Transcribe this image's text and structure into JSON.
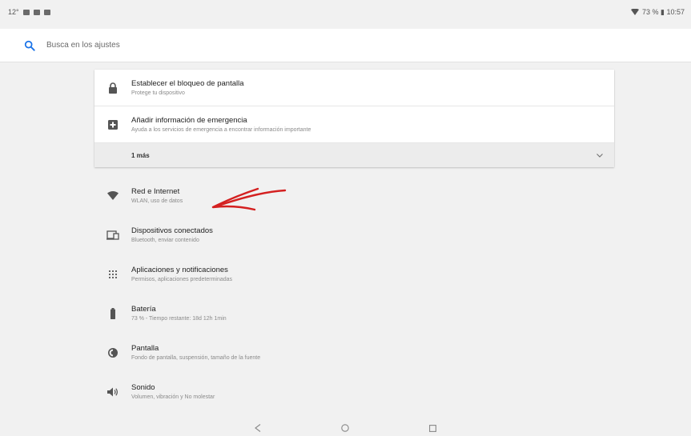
{
  "status_bar": {
    "left_text": "12°",
    "right_text": "73 % ▮ 10:57"
  },
  "search": {
    "placeholder": "Busca en los ajustes",
    "icon": "search-icon"
  },
  "suggestions": [
    {
      "icon": "lock-icon",
      "title": "Establecer el bloqueo de pantalla",
      "summary": "Protege tu dispositivo"
    },
    {
      "icon": "emergency-plus-icon",
      "title": "Añadir información de emergencia",
      "summary": "Ayuda a los servicios de emergencia a encontrar información importante"
    }
  ],
  "more_label": "1 más",
  "settings": [
    {
      "icon": "wifi-icon",
      "title": "Red e Internet",
      "summary": "WLAN, uso de datos"
    },
    {
      "icon": "connected-devices-icon",
      "title": "Dispositivos conectados",
      "summary": "Bluetooth, enviar contenido"
    },
    {
      "icon": "apps-icon",
      "title": "Aplicaciones y notificaciones",
      "summary": "Permisos, aplicaciones predeterminadas"
    },
    {
      "icon": "battery-icon",
      "title": "Batería",
      "summary": "73 % - Tiempo restante: 18d 12h 1min"
    },
    {
      "icon": "display-icon",
      "title": "Pantalla",
      "summary": "Fondo de pantalla, suspensión, tamaño de la fuente"
    },
    {
      "icon": "sound-icon",
      "title": "Sonido",
      "summary": "Volumen, vibración y No molestar"
    }
  ],
  "colors": {
    "background": "#f1f1f1",
    "card": "#ffffff",
    "annotation": "#d42020"
  }
}
